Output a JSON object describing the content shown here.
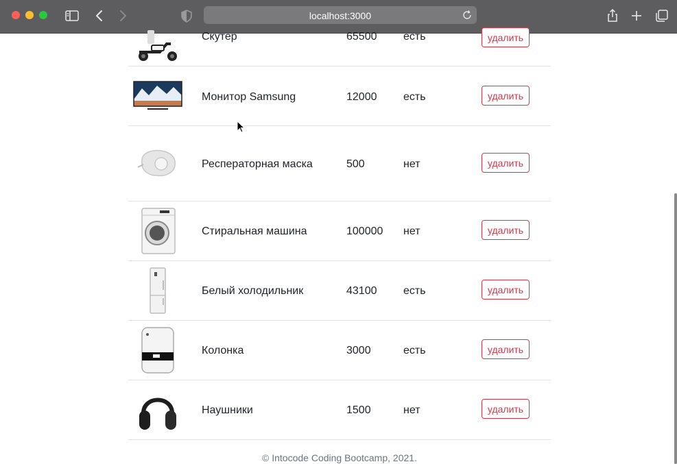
{
  "browser": {
    "url": "localhost:3000"
  },
  "products": [
    {
      "name": "Скутер",
      "price": "65500",
      "stock": "есть",
      "action": "удалить",
      "image_icon": "scooter-image"
    },
    {
      "name": "Монитор Samsung",
      "price": "12000",
      "stock": "есть",
      "action": "удалить",
      "image_icon": "monitor-image"
    },
    {
      "name": "Респераторная маска",
      "price": "500",
      "stock": "нет",
      "action": "удалить",
      "image_icon": "mask-image"
    },
    {
      "name": "Стиральная машина",
      "price": "100000",
      "stock": "нет",
      "action": "удалить",
      "image_icon": "washing-machine-image"
    },
    {
      "name": "Белый холодильник",
      "price": "43100",
      "stock": "есть",
      "action": "удалить",
      "image_icon": "fridge-image"
    },
    {
      "name": "Колонка",
      "price": "3000",
      "stock": "есть",
      "action": "удалить",
      "image_icon": "humidifier-image"
    },
    {
      "name": "Наушники",
      "price": "1500",
      "stock": "нет",
      "action": "удалить",
      "image_icon": "headphones-image"
    }
  ],
  "footer": {
    "text": "© Intocode Coding Bootcamp, 2021."
  },
  "colors": {
    "danger": "#dc3545",
    "chrome": "#5d5d5f",
    "divider": "#dee2e6"
  }
}
